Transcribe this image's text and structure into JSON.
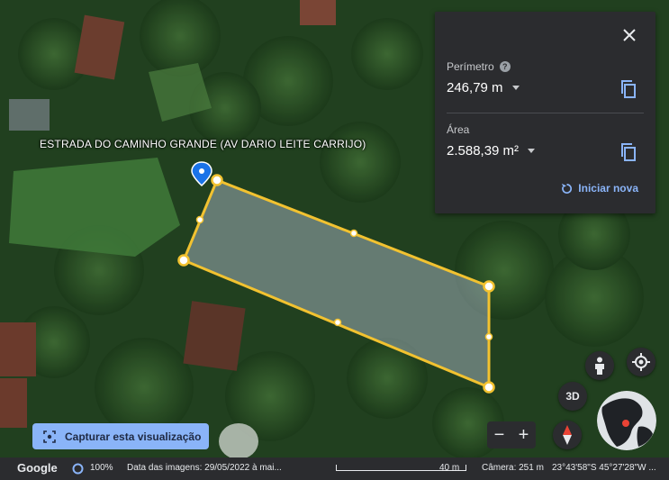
{
  "street_label": "ESTRADA DO CAMINHO GRANDE (AV DARIO LEITE CARRIJO)",
  "measure_panel": {
    "perimeter_label": "Perímetro",
    "perimeter_value": "246,79 m",
    "area_label": "Área",
    "area_value": "2.588,39 m²",
    "restart_label": "Iniciar nova"
  },
  "capture_button_label": "Capturar esta visualização",
  "btn_3d_label": "3D",
  "zoom": {
    "out": "−",
    "in": "+"
  },
  "footer": {
    "logo": "Google",
    "zoom_level": "100%",
    "imagery_date": "Data das imagens: 29/05/2022 à mai...",
    "scale": "40 m",
    "camera": "Câmera: 251 m",
    "coords": "23°43'58\"S 45°27'28\"W ..."
  },
  "colors": {
    "polygon_stroke": "#f2c230",
    "panel_bg": "#2b2c2f",
    "accent": "#8ab4f8",
    "pin": "#1a73e8"
  }
}
